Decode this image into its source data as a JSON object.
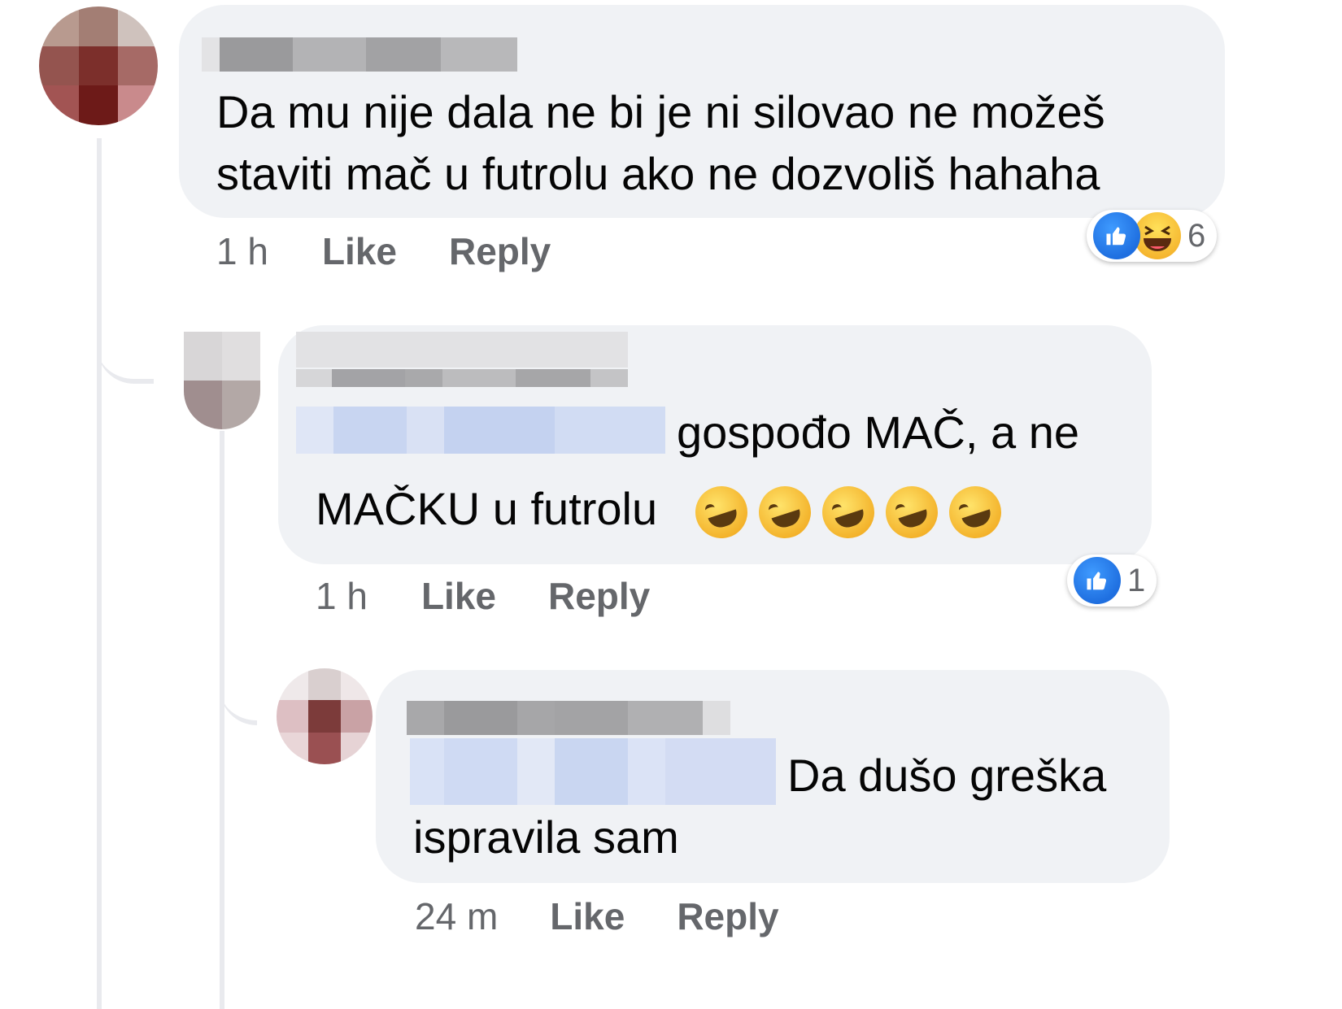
{
  "colors": {
    "bubble": "#f0f2f5",
    "like_blue": "#1f6fe0",
    "meta_text": "#65676b",
    "text": "#050505"
  },
  "comments": [
    {
      "text_lines": [
        "Da mu nije dala ne bi je ni silovao ne možeš",
        "staviti mač u futrolu ako ne dozvoliš hahaha"
      ],
      "time": "1 h",
      "like_label": "Like",
      "reply_label": "Reply",
      "reactions": {
        "icons": [
          "like-icon",
          "haha-icon"
        ],
        "count": "6"
      }
    },
    {
      "text_line_1": "gospođo MAČ, a ne",
      "text_line_2": "MAČKU u futrolu",
      "emoji_icon": "rolling-on-floor-laughing-emoji",
      "emoji_count": 5,
      "time": "1 h",
      "like_label": "Like",
      "reply_label": "Reply",
      "reactions": {
        "icons": [
          "like-icon"
        ],
        "count": "1"
      }
    },
    {
      "text_line_1": "Da dušo greška",
      "text_line_2": "ispravila sam",
      "time": "24 m",
      "like_label": "Like",
      "reply_label": "Reply"
    }
  ]
}
